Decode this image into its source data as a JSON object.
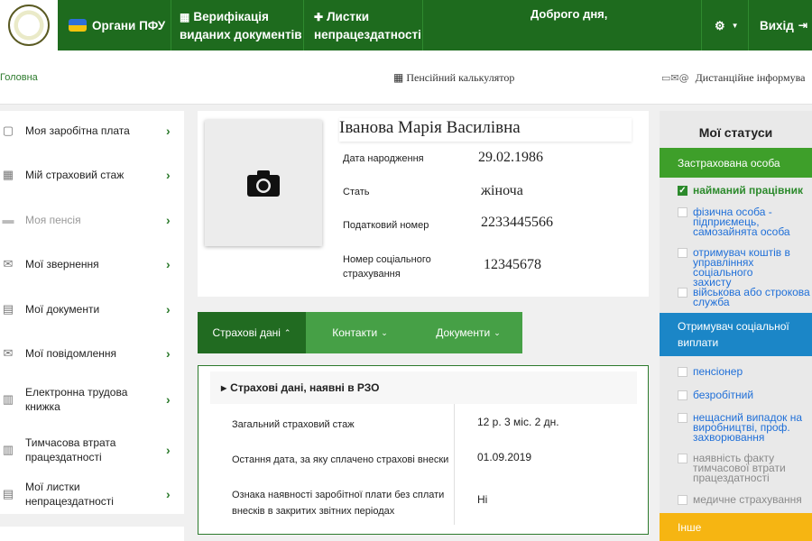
{
  "header": {
    "org_label": "Органи ПФУ",
    "verify_label_1": "Верифікація",
    "verify_label_2": "виданих документів",
    "sick_label_1": "Листки",
    "sick_label_2": "непрацездатності",
    "greeting": "Доброго дня,",
    "exit_label": "Вихід"
  },
  "subbar": {
    "breadcrumb": "Головна",
    "calculator": "Пенсійний калькулятор",
    "remote": "Дистанційне інформува"
  },
  "sidebar": {
    "items": [
      {
        "label": "Моя заробітна плата",
        "icon": "wallet-icon"
      },
      {
        "label": "Мій страховий стаж",
        "icon": "calendar-icon"
      },
      {
        "label": "Моя пенсія",
        "icon": "folder-icon"
      },
      {
        "label": "Мої звернення",
        "icon": "envelope-icon"
      },
      {
        "label": "Мої документи",
        "icon": "document-icon"
      },
      {
        "label": "Мої повідомлення",
        "icon": "envelope-icon"
      },
      {
        "label": "Електронна трудова книжка",
        "icon": "workbook-icon"
      },
      {
        "label": "Тимчасова втрата працездатності",
        "icon": "workbook-icon"
      },
      {
        "label": "Мої листки непрацездатності",
        "icon": "document-icon"
      }
    ]
  },
  "profile": {
    "name": "Іванова Марія Василівна",
    "birth_label": "Дата народження",
    "birth_value": "29.02.1986",
    "sex_label": "Стать",
    "sex_value": "жіноча",
    "tax_label": "Податковий номер",
    "tax_value": "2233445566",
    "social_label_1": "Номер соціального",
    "social_label_2": "страхування",
    "social_value": "12345678"
  },
  "tabs": [
    {
      "label": "Страхові дані"
    },
    {
      "label": "Контакти"
    },
    {
      "label": "Документи"
    }
  ],
  "insurance": {
    "heading": "Страхові дані, наявні в РЗО",
    "rows": [
      {
        "label": "Загальний страховий стаж",
        "value": "12 р. 3 міс. 2 дн."
      },
      {
        "label": "Остання дата, за яку сплачено страхові внески",
        "value": "01.09.2019"
      },
      {
        "label_1": "Ознака наявності заробітної плати без сплати",
        "label_2": "внесків в закритих звітних періодах",
        "value": "Ні"
      }
    ]
  },
  "statuses": {
    "title": "Мої статуси",
    "insured_header": "Застрахована особа",
    "insured_items": [
      {
        "lines": [
          "найманий працівник"
        ]
      },
      {
        "lines": [
          "фізична особа -",
          "підприємець,",
          "самозайнята особа"
        ]
      },
      {
        "lines": [
          "отримувач коштів в",
          "управліннях соціального",
          "захисту"
        ]
      },
      {
        "lines": [
          "військова або строкова",
          "служба"
        ]
      }
    ],
    "recipient_header_1": "Отримувач соціальної",
    "recipient_header_2": "виплати",
    "recipient_items": [
      {
        "lines": [
          "пенсіонер"
        ]
      },
      {
        "lines": [
          "безробітний"
        ]
      },
      {
        "lines": [
          "нещасний випадок на",
          "виробництві, проф.",
          "захворювання"
        ]
      },
      {
        "lines": [
          "наявність факту",
          "тимчасової втрати",
          "працездатності"
        ]
      },
      {
        "lines": [
          "медичне страхування"
        ]
      }
    ],
    "other_header": "Інше"
  },
  "colors": {
    "brand_green": "#1e6b1e",
    "tab_green": "#46a046",
    "insured_green": "#3e9f2a",
    "recipient_blue": "#1b86c7",
    "other_yellow": "#f6b512",
    "status_link_blue": "#1f6fd8"
  }
}
